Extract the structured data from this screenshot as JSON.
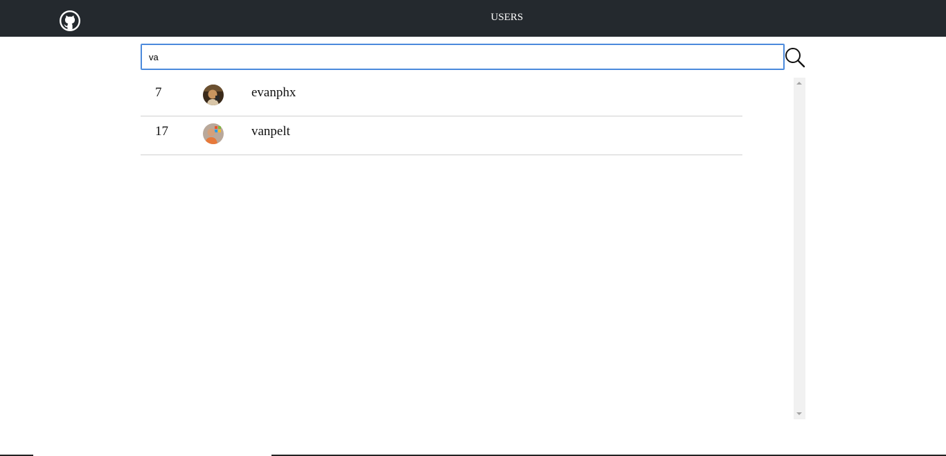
{
  "header": {
    "title": "USERS",
    "logo_icon": "github-logo-icon",
    "background": "#24292e"
  },
  "search": {
    "value": "va",
    "placeholder": "",
    "button_icon": "magnifier-icon",
    "focus_color": "#4a89dc"
  },
  "results": [
    {
      "rank": "7",
      "login": "evanphx",
      "avatar_icon": "user-avatar"
    },
    {
      "rank": "17",
      "login": "vanpelt",
      "avatar_icon": "user-avatar"
    }
  ]
}
